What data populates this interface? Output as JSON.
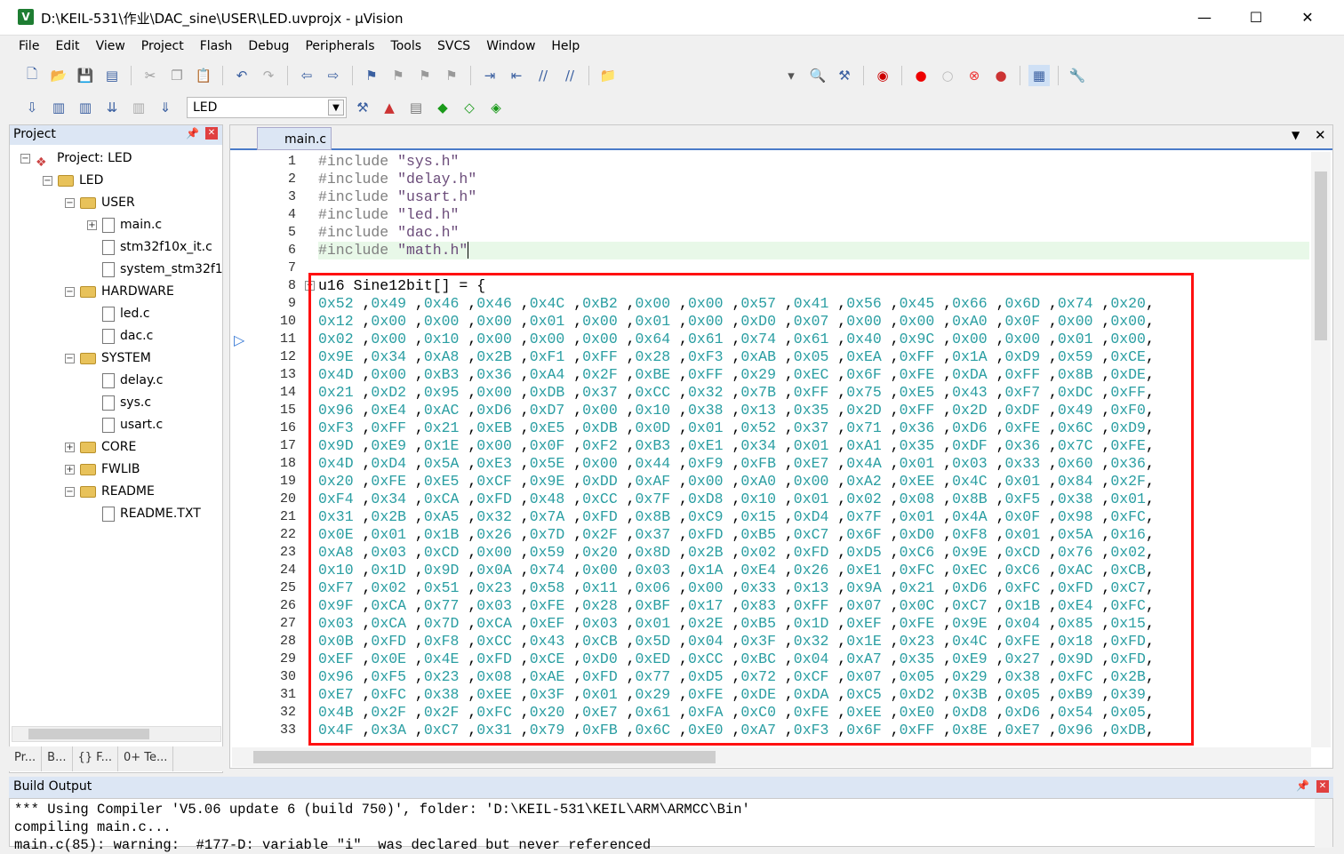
{
  "window": {
    "title": "D:\\KEIL-531\\作业\\DAC_sine\\USER\\LED.uvprojx - µVision",
    "app_icon": "V",
    "minimize": "—",
    "maximize": "☐",
    "close": "✕"
  },
  "menu": [
    "File",
    "Edit",
    "View",
    "Project",
    "Flash",
    "Debug",
    "Peripherals",
    "Tools",
    "SVCS",
    "Window",
    "Help"
  ],
  "toolbar": {
    "target": "LED"
  },
  "project": {
    "header": "Project",
    "tree": [
      {
        "label": "Project: LED",
        "depth": 0,
        "exp": "−",
        "type": "project"
      },
      {
        "label": "LED",
        "depth": 1,
        "exp": "−",
        "type": "folder"
      },
      {
        "label": "USER",
        "depth": 2,
        "exp": "−",
        "type": "folder"
      },
      {
        "label": "main.c",
        "depth": 3,
        "exp": "+",
        "type": "file"
      },
      {
        "label": "stm32f10x_it.c",
        "depth": 3,
        "exp": "",
        "type": "file"
      },
      {
        "label": "system_stm32f1",
        "depth": 3,
        "exp": "",
        "type": "file"
      },
      {
        "label": "HARDWARE",
        "depth": 2,
        "exp": "−",
        "type": "folder"
      },
      {
        "label": "led.c",
        "depth": 3,
        "exp": "",
        "type": "file"
      },
      {
        "label": "dac.c",
        "depth": 3,
        "exp": "",
        "type": "file"
      },
      {
        "label": "SYSTEM",
        "depth": 2,
        "exp": "−",
        "type": "folder"
      },
      {
        "label": "delay.c",
        "depth": 3,
        "exp": "",
        "type": "file"
      },
      {
        "label": "sys.c",
        "depth": 3,
        "exp": "",
        "type": "file"
      },
      {
        "label": "usart.c",
        "depth": 3,
        "exp": "",
        "type": "file"
      },
      {
        "label": "CORE",
        "depth": 2,
        "exp": "+",
        "type": "folder"
      },
      {
        "label": "FWLIB",
        "depth": 2,
        "exp": "+",
        "type": "folder"
      },
      {
        "label": "README",
        "depth": 2,
        "exp": "−",
        "type": "folder"
      },
      {
        "label": "README.TXT",
        "depth": 3,
        "exp": "",
        "type": "file"
      }
    ],
    "tabs": [
      "Pr...",
      "B...",
      "{} F...",
      "0+ Te..."
    ]
  },
  "editor": {
    "tab": "main.c",
    "includes": [
      {
        "n": "1",
        "d": "#include",
        "s": "\"sys.h\""
      },
      {
        "n": "2",
        "d": "#include",
        "s": "\"delay.h\""
      },
      {
        "n": "3",
        "d": "#include",
        "s": "\"usart.h\""
      },
      {
        "n": "4",
        "d": "#include",
        "s": "\"led.h\""
      },
      {
        "n": "5",
        "d": "#include",
        "s": "\"dac.h\""
      },
      {
        "n": "6",
        "d": "#include",
        "s": "\"math.h\""
      }
    ],
    "line7": "7",
    "decl": {
      "n": "8",
      "text": "u16 Sine12bit[] = {"
    },
    "hex_lines": [
      {
        "n": "9",
        "v": [
          "0x52",
          "0x49",
          "0x46",
          "0x46",
          "0x4C",
          "0xB2",
          "0x00",
          "0x00",
          "0x57",
          "0x41",
          "0x56",
          "0x45",
          "0x66",
          "0x6D",
          "0x74",
          "0x20"
        ]
      },
      {
        "n": "10",
        "v": [
          "0x12",
          "0x00",
          "0x00",
          "0x00",
          "0x01",
          "0x00",
          "0x01",
          "0x00",
          "0xD0",
          "0x07",
          "0x00",
          "0x00",
          "0xA0",
          "0x0F",
          "0x00",
          "0x00"
        ]
      },
      {
        "n": "11",
        "v": [
          "0x02",
          "0x00",
          "0x10",
          "0x00",
          "0x00",
          "0x00",
          "0x64",
          "0x61",
          "0x74",
          "0x61",
          "0x40",
          "0x9C",
          "0x00",
          "0x00",
          "0x01",
          "0x00"
        ]
      },
      {
        "n": "12",
        "v": [
          "0x9E",
          "0x34",
          "0xA8",
          "0x2B",
          "0xF1",
          "0xFF",
          "0x28",
          "0xF3",
          "0xAB",
          "0x05",
          "0xEA",
          "0xFF",
          "0x1A",
          "0xD9",
          "0x59",
          "0xCE"
        ]
      },
      {
        "n": "13",
        "v": [
          "0x4D",
          "0x00",
          "0xB3",
          "0x36",
          "0xA4",
          "0x2F",
          "0xBE",
          "0xFF",
          "0x29",
          "0xEC",
          "0x6F",
          "0xFE",
          "0xDA",
          "0xFF",
          "0x8B",
          "0xDE"
        ]
      },
      {
        "n": "14",
        "v": [
          "0x21",
          "0xD2",
          "0x95",
          "0x00",
          "0xDB",
          "0x37",
          "0xCC",
          "0x32",
          "0x7B",
          "0xFF",
          "0x75",
          "0xE5",
          "0x43",
          "0xF7",
          "0xDC",
          "0xFF"
        ]
      },
      {
        "n": "15",
        "v": [
          "0x96",
          "0xE4",
          "0xAC",
          "0xD6",
          "0xD7",
          "0x00",
          "0x10",
          "0x38",
          "0x13",
          "0x35",
          "0x2D",
          "0xFF",
          "0x2D",
          "0xDF",
          "0x49",
          "0xF0"
        ]
      },
      {
        "n": "16",
        "v": [
          "0xF3",
          "0xFF",
          "0x21",
          "0xEB",
          "0xE5",
          "0xDB",
          "0x0D",
          "0x01",
          "0x52",
          "0x37",
          "0x71",
          "0x36",
          "0xD6",
          "0xFE",
          "0x6C",
          "0xD9"
        ]
      },
      {
        "n": "17",
        "v": [
          "0x9D",
          "0xE9",
          "0x1E",
          "0x00",
          "0x0F",
          "0xF2",
          "0xB3",
          "0xE1",
          "0x34",
          "0x01",
          "0xA1",
          "0x35",
          "0xDF",
          "0x36",
          "0x7C",
          "0xFE"
        ]
      },
      {
        "n": "18",
        "v": [
          "0x4D",
          "0xD4",
          "0x5A",
          "0xE3",
          "0x5E",
          "0x00",
          "0x44",
          "0xF9",
          "0xFB",
          "0xE7",
          "0x4A",
          "0x01",
          "0x03",
          "0x33",
          "0x60",
          "0x36"
        ]
      },
      {
        "n": "19",
        "v": [
          "0x20",
          "0xFE",
          "0xE5",
          "0xCF",
          "0x9E",
          "0xDD",
          "0xAF",
          "0x00",
          "0xA0",
          "0x00",
          "0xA2",
          "0xEE",
          "0x4C",
          "0x01",
          "0x84",
          "0x2F"
        ]
      },
      {
        "n": "20",
        "v": [
          "0xF4",
          "0x34",
          "0xCA",
          "0xFD",
          "0x48",
          "0xCC",
          "0x7F",
          "0xD8",
          "0x10",
          "0x01",
          "0x02",
          "0x08",
          "0x8B",
          "0xF5",
          "0x38",
          "0x01"
        ]
      },
      {
        "n": "21",
        "v": [
          "0x31",
          "0x2B",
          "0xA5",
          "0x32",
          "0x7A",
          "0xFD",
          "0x8B",
          "0xC9",
          "0x15",
          "0xD4",
          "0x7F",
          "0x01",
          "0x4A",
          "0x0F",
          "0x98",
          "0xFC"
        ]
      },
      {
        "n": "22",
        "v": [
          "0x0E",
          "0x01",
          "0x1B",
          "0x26",
          "0x7D",
          "0x2F",
          "0x37",
          "0xFD",
          "0xB5",
          "0xC7",
          "0x6F",
          "0xD0",
          "0xF8",
          "0x01",
          "0x5A",
          "0x16"
        ]
      },
      {
        "n": "23",
        "v": [
          "0xA8",
          "0x03",
          "0xCD",
          "0x00",
          "0x59",
          "0x20",
          "0x8D",
          "0x2B",
          "0x02",
          "0xFD",
          "0xD5",
          "0xC6",
          "0x9E",
          "0xCD",
          "0x76",
          "0x02"
        ]
      },
      {
        "n": "24",
        "v": [
          "0x10",
          "0x1D",
          "0x9D",
          "0x0A",
          "0x74",
          "0x00",
          "0x03",
          "0x1A",
          "0xE4",
          "0x26",
          "0xE1",
          "0xFC",
          "0xEC",
          "0xC6",
          "0xAC",
          "0xCB"
        ]
      },
      {
        "n": "25",
        "v": [
          "0xF7",
          "0x02",
          "0x51",
          "0x23",
          "0x58",
          "0x11",
          "0x06",
          "0x00",
          "0x33",
          "0x13",
          "0x9A",
          "0x21",
          "0xD6",
          "0xFC",
          "0xFD",
          "0xC7"
        ]
      },
      {
        "n": "26",
        "v": [
          "0x9F",
          "0xCA",
          "0x77",
          "0x03",
          "0xFE",
          "0x28",
          "0xBF",
          "0x17",
          "0x83",
          "0xFF",
          "0x07",
          "0x0C",
          "0xC7",
          "0x1B",
          "0xE4",
          "0xFC"
        ]
      },
      {
        "n": "27",
        "v": [
          "0x03",
          "0xCA",
          "0x7D",
          "0xCA",
          "0xEF",
          "0x03",
          "0x01",
          "0x2E",
          "0xB5",
          "0x1D",
          "0xEF",
          "0xFE",
          "0x9E",
          "0x04",
          "0x85",
          "0x15"
        ]
      },
      {
        "n": "28",
        "v": [
          "0x0B",
          "0xFD",
          "0xF8",
          "0xCC",
          "0x43",
          "0xCB",
          "0x5D",
          "0x04",
          "0x3F",
          "0x32",
          "0x1E",
          "0x23",
          "0x4C",
          "0xFE",
          "0x18",
          "0xFD"
        ]
      },
      {
        "n": "29",
        "v": [
          "0xEF",
          "0x0E",
          "0x4E",
          "0xFD",
          "0xCE",
          "0xD0",
          "0xED",
          "0xCC",
          "0xBC",
          "0x04",
          "0xA7",
          "0x35",
          "0xE9",
          "0x27",
          "0x9D",
          "0xFD"
        ]
      },
      {
        "n": "30",
        "v": [
          "0x96",
          "0xF5",
          "0x23",
          "0x08",
          "0xAE",
          "0xFD",
          "0x77",
          "0xD5",
          "0x72",
          "0xCF",
          "0x07",
          "0x05",
          "0x29",
          "0x38",
          "0xFC",
          "0x2B"
        ]
      },
      {
        "n": "31",
        "v": [
          "0xE7",
          "0xFC",
          "0x38",
          "0xEE",
          "0x3F",
          "0x01",
          "0x29",
          "0xFE",
          "0xDE",
          "0xDA",
          "0xC5",
          "0xD2",
          "0x3B",
          "0x05",
          "0xB9",
          "0x39"
        ]
      },
      {
        "n": "32",
        "v": [
          "0x4B",
          "0x2F",
          "0x2F",
          "0xFC",
          "0x20",
          "0xE7",
          "0x61",
          "0xFA",
          "0xC0",
          "0xFE",
          "0xEE",
          "0xE0",
          "0xD8",
          "0xD6",
          "0x54",
          "0x05"
        ]
      },
      {
        "n": "33",
        "v": [
          "0x4F",
          "0x3A",
          "0xC7",
          "0x31",
          "0x79",
          "0xFB",
          "0x6C",
          "0xE0",
          "0xA7",
          "0xF3",
          "0x6F",
          "0xFF",
          "0x8E",
          "0xE7",
          "0x96",
          "0xDB"
        ]
      }
    ]
  },
  "build": {
    "header": "Build Output",
    "lines": [
      "*** Using Compiler 'V5.06 update 6 (build 750)', folder: 'D:\\KEIL-531\\KEIL\\ARM\\ARMCC\\Bin'",
      "compiling main.c...",
      "main.c(85): warning:  #177-D: variable \"i\"  was declared but never referenced"
    ]
  },
  "colors": {
    "highlight_box": "#ff1010",
    "hex_literal": "#2a9ea2",
    "current_line": "#e8f8e8"
  }
}
